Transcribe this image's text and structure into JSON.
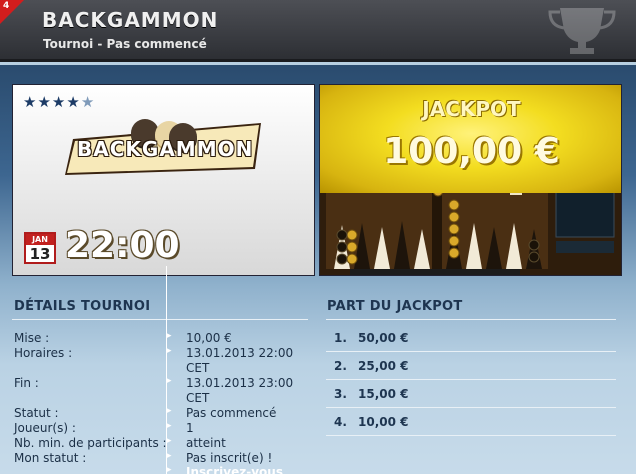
{
  "header": {
    "corner_number": "4",
    "title": "BACKGAMMON",
    "subtitle": "Tournoi - Pas commencé"
  },
  "game_card": {
    "rating": 4,
    "rating_max": 5,
    "logo_text": "BACKGAMMON",
    "calendar_month": "JAN",
    "calendar_day": "13",
    "start_time": "22:00"
  },
  "jackpot_card": {
    "label": "JACKPOT",
    "amount": "100,00 €"
  },
  "details": {
    "title": "DÉTAILS TOURNOI",
    "rows": [
      {
        "label": "Mise :",
        "value": "10,00 €"
      },
      {
        "label": "Horaires :",
        "value": "13.01.2013 22:00 CET"
      },
      {
        "label": "Fin :",
        "value": "13.01.2013 23:00 CET"
      },
      {
        "label": "Statut :",
        "value": "Pas commencé"
      },
      {
        "label": "Joueur(s) :",
        "value": "1"
      },
      {
        "label": "Nb. min. de participants :",
        "value": "atteint"
      },
      {
        "label": "Mon statut :",
        "value": "Pas inscrit(e) !"
      }
    ],
    "register_link": "Inscrivez-vous"
  },
  "jackpot_share": {
    "title": "PART DU JACKPOT",
    "rows": [
      {
        "rank": "1.",
        "amount": "50,00 €"
      },
      {
        "rank": "2.",
        "amount": "25,00 €"
      },
      {
        "rank": "3.",
        "amount": "15,00 €"
      },
      {
        "rank": "4.",
        "amount": "10,00 €"
      }
    ]
  },
  "colors": {
    "header_bg": "#3a3c42",
    "accent_red": "#d21d1d",
    "jackpot_yellow": "#f3dd20",
    "heading_blue": "#1e3550"
  }
}
